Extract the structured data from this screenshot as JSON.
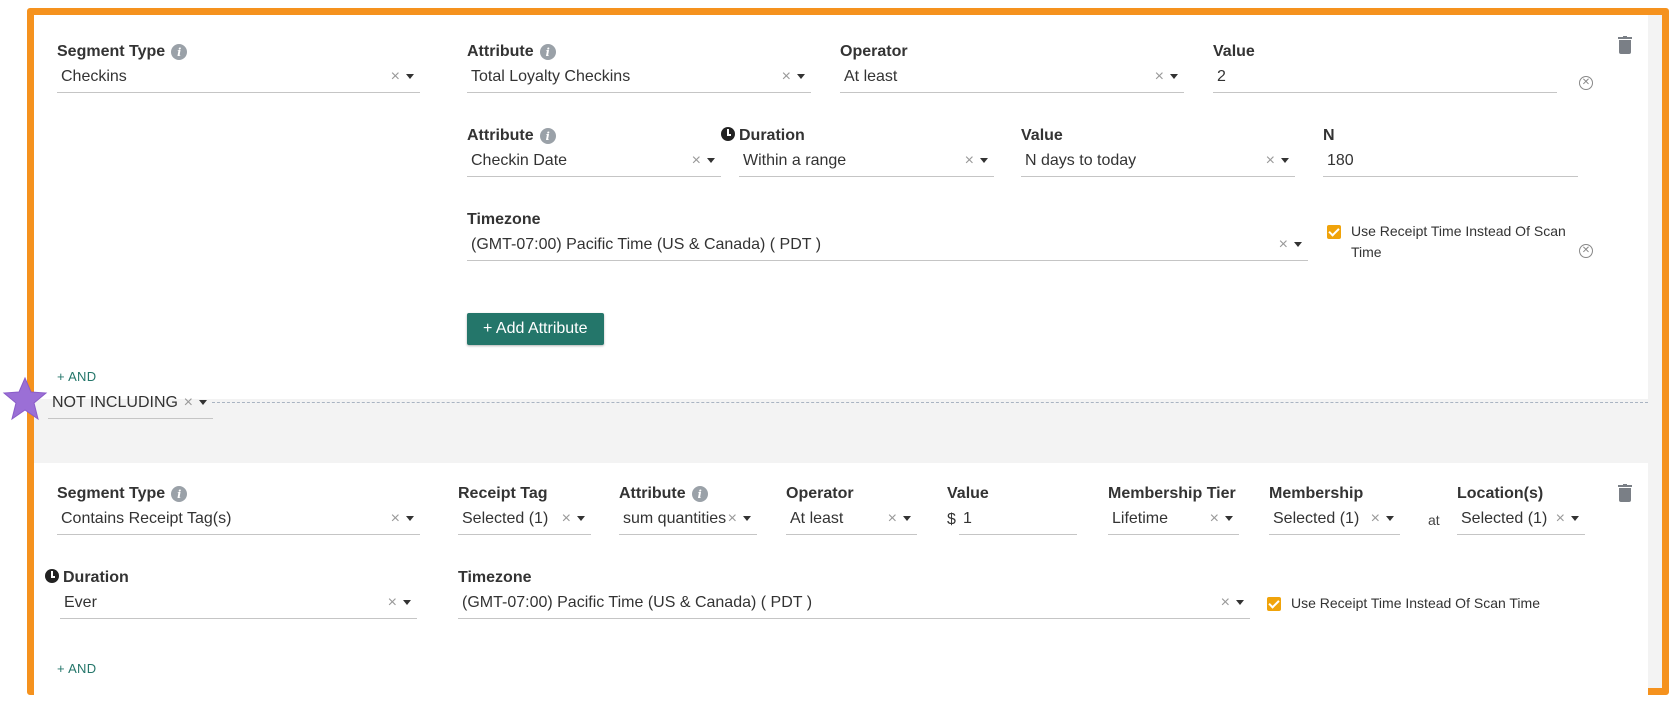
{
  "block1": {
    "segment_type": {
      "label": "Segment Type",
      "value": "Checkins"
    },
    "attribute1": {
      "label": "Attribute",
      "value": "Total Loyalty Checkins"
    },
    "operator": {
      "label": "Operator",
      "value": "At least"
    },
    "value1": {
      "label": "Value",
      "value": "2"
    },
    "attribute2": {
      "label": "Attribute",
      "value": "Checkin Date"
    },
    "duration": {
      "label": "Duration",
      "value": "Within a range"
    },
    "value2": {
      "label": "Value",
      "value": "N days to today"
    },
    "n": {
      "label": "N",
      "value": "180"
    },
    "timezone": {
      "label": "Timezone",
      "value": "(GMT-07:00) Pacific Time (US & Canada) ( PDT )"
    },
    "use_receipt_time": {
      "label": "Use Receipt Time Instead Of Scan Time",
      "checked": true
    },
    "add_attribute_label": "+ Add Attribute",
    "and_label": "+ AND"
  },
  "combinator": {
    "value": "NOT INCLUDING"
  },
  "block2": {
    "segment_type": {
      "label": "Segment Type",
      "value": "Contains Receipt Tag(s)"
    },
    "receipt_tag": {
      "label": "Receipt Tag",
      "value": "Selected (1)"
    },
    "attribute": {
      "label": "Attribute",
      "value": "sum quantities"
    },
    "operator": {
      "label": "Operator",
      "value": "At least"
    },
    "value": {
      "label": "Value",
      "prefix": "$",
      "value": "1"
    },
    "membership_tier": {
      "label": "Membership Tier",
      "value": "Lifetime"
    },
    "membership": {
      "label": "Membership",
      "value": "Selected (1)"
    },
    "at_label": "at",
    "locations": {
      "label": "Location(s)",
      "value": "Selected (1)"
    },
    "duration": {
      "label": "Duration",
      "value": "Ever"
    },
    "timezone": {
      "label": "Timezone",
      "value": "(GMT-07:00) Pacific Time (US & Canada) ( PDT )"
    },
    "use_receipt_time": {
      "label": "Use Receipt Time Instead Of Scan Time",
      "checked": true
    },
    "and_label": "+ AND"
  },
  "colors": {
    "frame": "#f5921e",
    "accent": "#24766a",
    "checkbox": "#f0a30a",
    "star": "#9b6fd6"
  },
  "icons": [
    "info-icon",
    "clock-icon",
    "trash-icon",
    "remove-icon",
    "close-icon",
    "chevron-down-icon",
    "star-marker-icon"
  ]
}
